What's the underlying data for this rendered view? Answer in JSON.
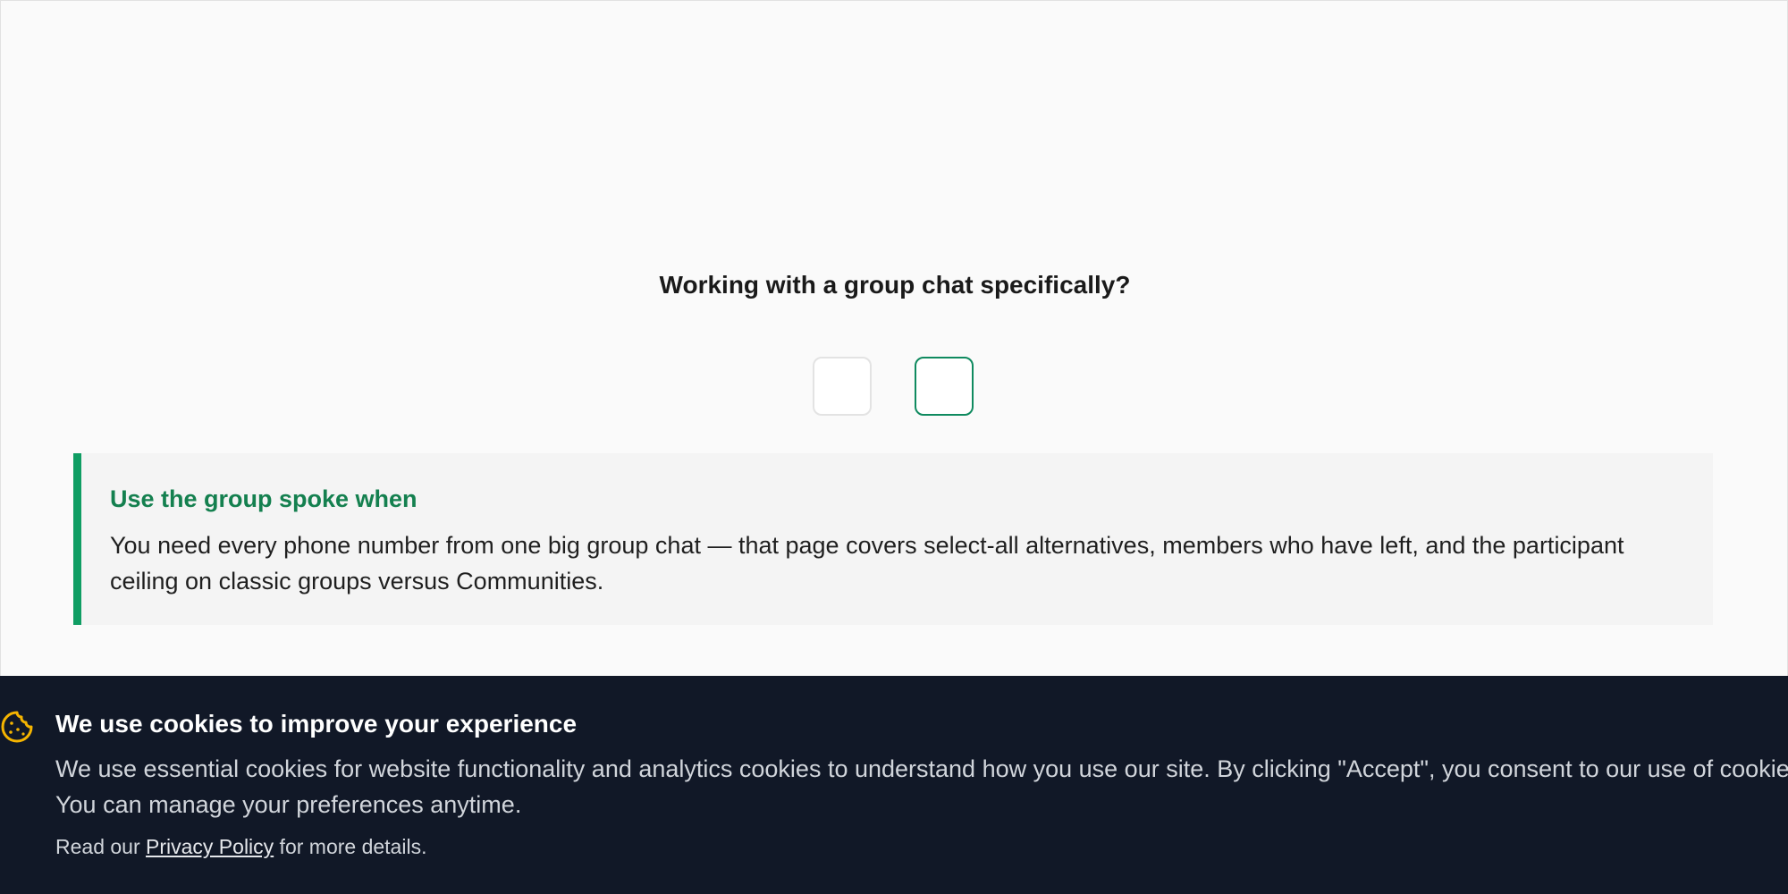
{
  "question": {
    "text": "Working with a group chat specifically?"
  },
  "choices": {
    "selected_index": 1
  },
  "callout": {
    "title": "Use the group spoke when",
    "body": "You need every phone number from one big group chat — that page covers select-all alternatives, members who have left, and the participant ceiling on classic groups versus Communities."
  },
  "cookie_banner": {
    "icon": "cookie-icon",
    "title": "We use cookies to improve your experience",
    "description": "We use essential cookies for website functionality and analytics cookies to understand how you use our site. By clicking \"Accept\", you consent to our use of cookies. You can manage your preferences anytime.",
    "privacy_prefix": "Read our ",
    "privacy_link": "Privacy Policy",
    "privacy_suffix": " for more details."
  },
  "colors": {
    "accent": "#0f9d63",
    "accent_text": "#14804f",
    "banner_bg": "#111827",
    "cookie_icon": "#f5b400"
  }
}
